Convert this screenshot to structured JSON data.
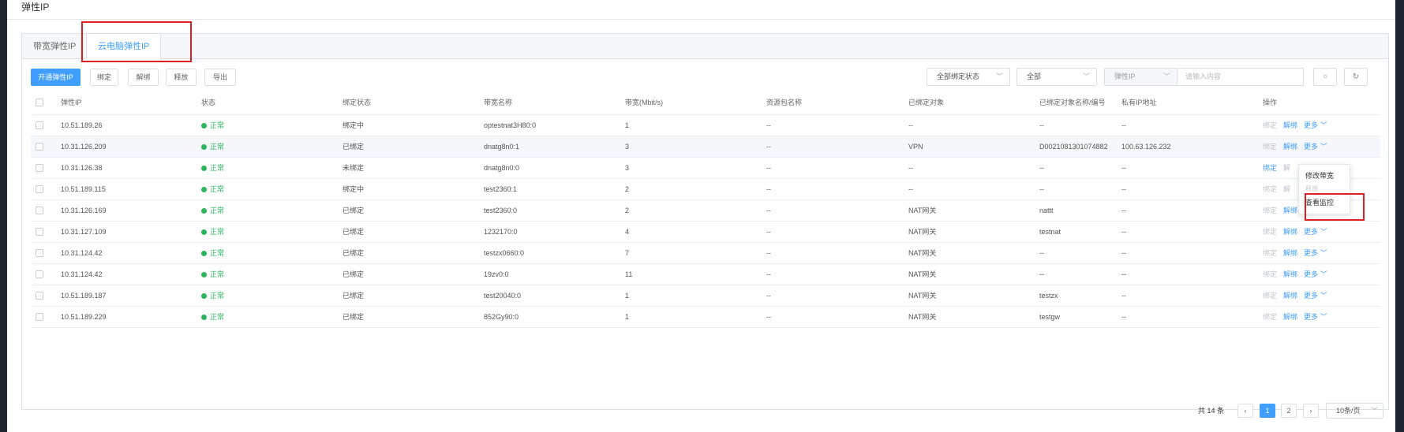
{
  "page": {
    "title": "弹性IP"
  },
  "tabs": [
    {
      "label": "带宽弹性IP",
      "active": false
    },
    {
      "label": "云电脑弹性IP",
      "active": true
    }
  ],
  "toolbar": {
    "open_label": "开通弹性IP",
    "bind_label": "绑定",
    "unbind_label": "解绑",
    "release_label": "释放",
    "export_label": "导出"
  },
  "filters": {
    "bind_status": "全部绑定状态",
    "all": "全部",
    "search_field": "弹性IP",
    "search_placeholder": "请输入内容"
  },
  "table": {
    "headers": [
      "弹性IP",
      "状态",
      "绑定状态",
      "带宽名称",
      "带宽(Mbit/s)",
      "资源包名称",
      "已绑定对象",
      "已绑定对象名称/编号",
      "私有IP地址",
      "操作"
    ],
    "rows": [
      {
        "ip": "10.51.189.26",
        "status": "正常",
        "bind": "绑定中",
        "bw_name": "optestnat3H80:0",
        "bw": "1",
        "pkg": "--",
        "obj": "--",
        "obj_name": "--",
        "private_ip": "--",
        "op1": "绑定",
        "op2": "解绑",
        "op3": "更多"
      },
      {
        "ip": "10.31.126.209",
        "status": "正常",
        "bind": "已绑定",
        "bw_name": "dnatg8n0:1",
        "bw": "3",
        "pkg": "--",
        "obj": "VPN",
        "obj_name": "D0021081301074882",
        "private_ip": "100.63.126.232",
        "op1": "绑定",
        "op2": "解绑",
        "op3": "更多"
      },
      {
        "ip": "10.31.126.38",
        "status": "正常",
        "bind": "未绑定",
        "bw_name": "dnatg8n0:0",
        "bw": "3",
        "pkg": "--",
        "obj": "--",
        "obj_name": "--",
        "private_ip": "--",
        "op1": "绑定",
        "op2": "解",
        "op3": ""
      },
      {
        "ip": "10.51.189.115",
        "status": "正常",
        "bind": "绑定中",
        "bw_name": "test2360:1",
        "bw": "2",
        "pkg": "--",
        "obj": "--",
        "obj_name": "--",
        "private_ip": "--",
        "op1": "绑定",
        "op2": "解",
        "op3": ""
      },
      {
        "ip": "10.31.126.169",
        "status": "正常",
        "bind": "已绑定",
        "bw_name": "test2360:0",
        "bw": "2",
        "pkg": "--",
        "obj": "NAT网关",
        "obj_name": "nattt",
        "private_ip": "--",
        "op1": "绑定",
        "op2": "解绑",
        "op3": "更多"
      },
      {
        "ip": "10.31.127.109",
        "status": "正常",
        "bind": "已绑定",
        "bw_name": "1232170:0",
        "bw": "4",
        "pkg": "--",
        "obj": "NAT网关",
        "obj_name": "testnat",
        "private_ip": "--",
        "op1": "绑定",
        "op2": "解绑",
        "op3": "更多"
      },
      {
        "ip": "10.31.124.42",
        "status": "正常",
        "bind": "已绑定",
        "bw_name": "testzx0660:0",
        "bw": "7",
        "pkg": "--",
        "obj": "NAT网关",
        "obj_name": "--",
        "private_ip": "--",
        "op1": "绑定",
        "op2": "解绑",
        "op3": "更多"
      },
      {
        "ip": "10.31.124.42",
        "status": "正常",
        "bind": "已绑定",
        "bw_name": "19zv0:0",
        "bw": "11",
        "pkg": "--",
        "obj": "NAT网关",
        "obj_name": "--",
        "private_ip": "--",
        "op1": "绑定",
        "op2": "解绑",
        "op3": "更多"
      },
      {
        "ip": "10.51.189.187",
        "status": "正常",
        "bind": "已绑定",
        "bw_name": "test20040:0",
        "bw": "1",
        "pkg": "--",
        "obj": "NAT网关",
        "obj_name": "testzx",
        "private_ip": "--",
        "op1": "绑定",
        "op2": "解绑",
        "op3": "更多"
      },
      {
        "ip": "10.51.189.229",
        "status": "正常",
        "bind": "已绑定",
        "bw_name": "852Gy90:0",
        "bw": "1",
        "pkg": "--",
        "obj": "NAT网关",
        "obj_name": "testgw",
        "private_ip": "--",
        "op1": "绑定",
        "op2": "解绑",
        "op3": "更多"
      }
    ]
  },
  "dropdown": {
    "items": [
      "修改带宽",
      "释放",
      "查看监控"
    ]
  },
  "pagination": {
    "total": "共 14 条",
    "page1": "1",
    "page2": "2",
    "page_size": "10条/页"
  },
  "colors": {
    "accent": "#409eff",
    "success": "#2db55d",
    "highlight": "#e02020"
  }
}
